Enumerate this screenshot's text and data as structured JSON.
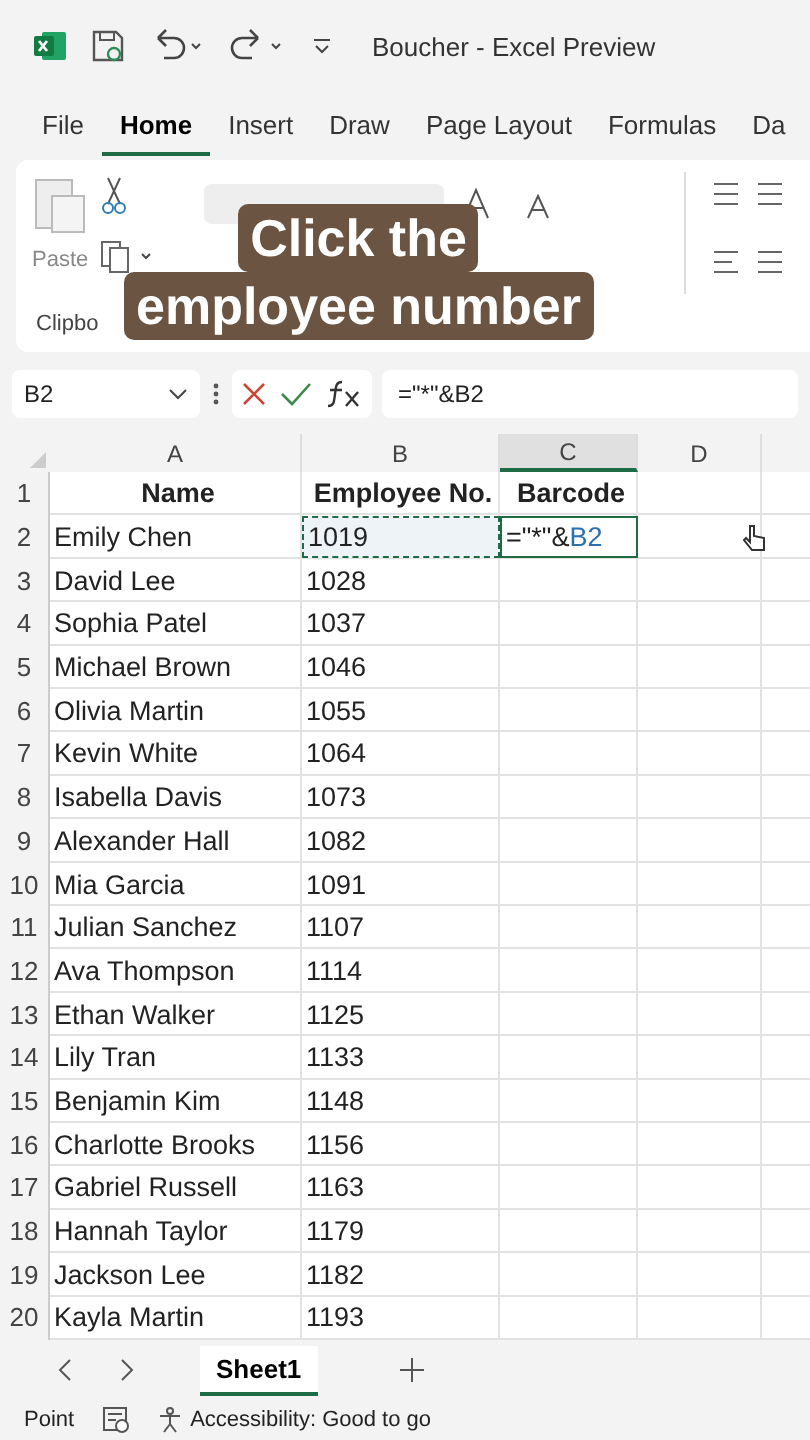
{
  "window": {
    "title": "Boucher  -  Excel Preview"
  },
  "tabs": [
    {
      "label": "File",
      "selected": false
    },
    {
      "label": "Home",
      "selected": true
    },
    {
      "label": "Insert",
      "selected": false
    },
    {
      "label": "Draw",
      "selected": false
    },
    {
      "label": "Page Layout",
      "selected": false
    },
    {
      "label": "Formulas",
      "selected": false
    },
    {
      "label": "Da",
      "selected": false
    }
  ],
  "ribbon": {
    "paste_label": "Paste",
    "group_label": "Clipbo"
  },
  "overlay": {
    "lines": [
      "Click the",
      "employee number"
    ]
  },
  "formula_bar": {
    "name_box": "B2",
    "formula": "=\"*\"&B2"
  },
  "columns": [
    {
      "label": "A",
      "selected": false
    },
    {
      "label": "B",
      "selected": false
    },
    {
      "label": "C",
      "selected": true
    },
    {
      "label": "D",
      "selected": false
    }
  ],
  "rows": [
    {
      "number": "1",
      "cells": [
        "Name",
        "Employee No.",
        "Barcode",
        ""
      ]
    },
    {
      "number": "2",
      "cells": [
        "Emily Chen",
        "1019",
        "=\"*\"&",
        ""
      ],
      "ref": "B2"
    },
    {
      "number": "3",
      "cells": [
        "David Lee",
        "1028",
        "",
        ""
      ]
    },
    {
      "number": "4",
      "cells": [
        "Sophia Patel",
        "1037",
        "",
        ""
      ]
    },
    {
      "number": "5",
      "cells": [
        "Michael Brown",
        "1046",
        "",
        ""
      ]
    },
    {
      "number": "6",
      "cells": [
        "Olivia Martin",
        "1055",
        "",
        ""
      ]
    },
    {
      "number": "7",
      "cells": [
        "Kevin White",
        "1064",
        "",
        ""
      ]
    },
    {
      "number": "8",
      "cells": [
        "Isabella Davis",
        "1073",
        "",
        ""
      ]
    },
    {
      "number": "9",
      "cells": [
        "Alexander Hall",
        "1082",
        "",
        ""
      ]
    },
    {
      "number": "10",
      "cells": [
        "Mia Garcia",
        "1091",
        "",
        ""
      ]
    },
    {
      "number": "11",
      "cells": [
        "Julian Sanchez",
        "1107",
        "",
        ""
      ]
    },
    {
      "number": "12",
      "cells": [
        "Ava Thompson",
        "1114",
        "",
        ""
      ]
    },
    {
      "number": "13",
      "cells": [
        "Ethan Walker",
        "1125",
        "",
        ""
      ]
    },
    {
      "number": "14",
      "cells": [
        "Lily Tran",
        "1133",
        "",
        ""
      ]
    },
    {
      "number": "15",
      "cells": [
        "Benjamin Kim",
        "1148",
        "",
        ""
      ]
    },
    {
      "number": "16",
      "cells": [
        "Charlotte Brooks",
        "1156",
        "",
        ""
      ]
    },
    {
      "number": "17",
      "cells": [
        "Gabriel Russell",
        "1163",
        "",
        ""
      ]
    },
    {
      "number": "18",
      "cells": [
        "Hannah Taylor",
        "1179",
        "",
        ""
      ]
    },
    {
      "number": "19",
      "cells": [
        "Jackson Lee",
        "1182",
        "",
        ""
      ]
    },
    {
      "number": "20",
      "cells": [
        "Kayla Martin",
        "1193",
        "",
        ""
      ]
    }
  ],
  "sheet_tabs": [
    {
      "label": "Sheet1",
      "selected": true
    }
  ],
  "status_bar": {
    "mode": "Point",
    "accessibility": "Accessibility: Good to go"
  }
}
